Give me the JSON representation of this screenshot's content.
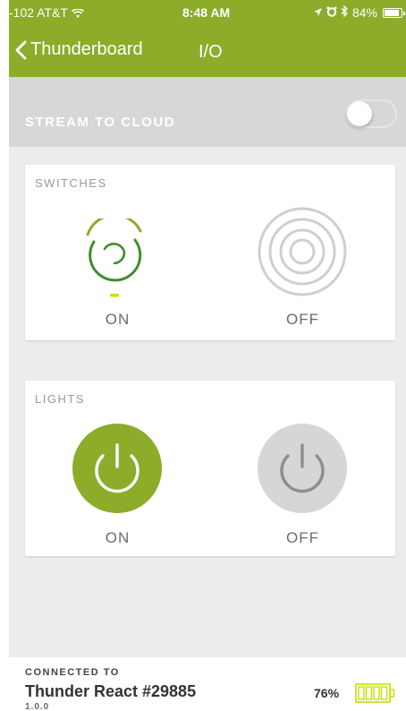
{
  "status_bar": {
    "carrier": "-102 AT&T",
    "time": "8:48 AM",
    "battery": "84%"
  },
  "nav": {
    "back_label": "Thunderboard",
    "title": "I/O"
  },
  "stream": {
    "label": "STREAM TO CLOUD",
    "enabled": false
  },
  "switches": {
    "title": "SWITCHES",
    "left_state": "ON",
    "right_state": "OFF"
  },
  "lights": {
    "title": "LIGHTS",
    "left_state": "ON",
    "right_state": "OFF"
  },
  "footer": {
    "connected_label": "CONNECTED TO",
    "device_name": "Thunder React #29885",
    "version": "1.0.0",
    "battery_percent": "76%"
  },
  "colors": {
    "accent": "#8cac2a",
    "accent_light": "#c7e000",
    "switch_green": "#3d8f2a",
    "off_gray": "#cfcfcf"
  },
  "icons": {
    "switch_on": "spinner-ring-icon",
    "switch_off": "concentric-rings-icon",
    "light_on": "power-icon",
    "light_off": "power-icon",
    "battery": "battery-icon"
  }
}
